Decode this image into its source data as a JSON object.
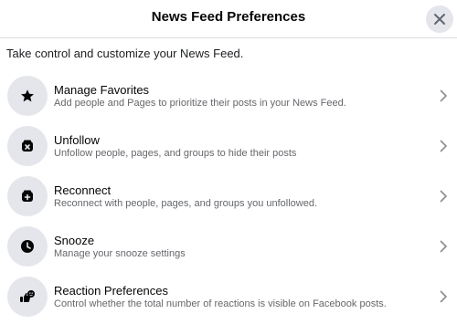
{
  "header": {
    "title": "News Feed Preferences",
    "close_icon": "close-icon"
  },
  "intro": "Take control and customize your News Feed.",
  "items": [
    {
      "title": "Manage Favorites",
      "description": "Add people and Pages to prioritize their posts in your News Feed.",
      "icon": "star-icon"
    },
    {
      "title": "Unfollow",
      "description": "Unfollow people, pages, and groups to hide their posts",
      "icon": "unfollow-icon"
    },
    {
      "title": "Reconnect",
      "description": "Reconnect with people, pages, and groups you unfollowed.",
      "icon": "reconnect-icon"
    },
    {
      "title": "Snooze",
      "description": "Manage your snooze settings",
      "icon": "clock-icon"
    },
    {
      "title": "Reaction Preferences",
      "description": "Control whether the total number of reactions is visible on Facebook posts.",
      "icon": "reactions-icon"
    }
  ],
  "colors": {
    "icon_bg": "#e4e6eb",
    "text_secondary": "#65676b",
    "divider": "#dadde1"
  }
}
